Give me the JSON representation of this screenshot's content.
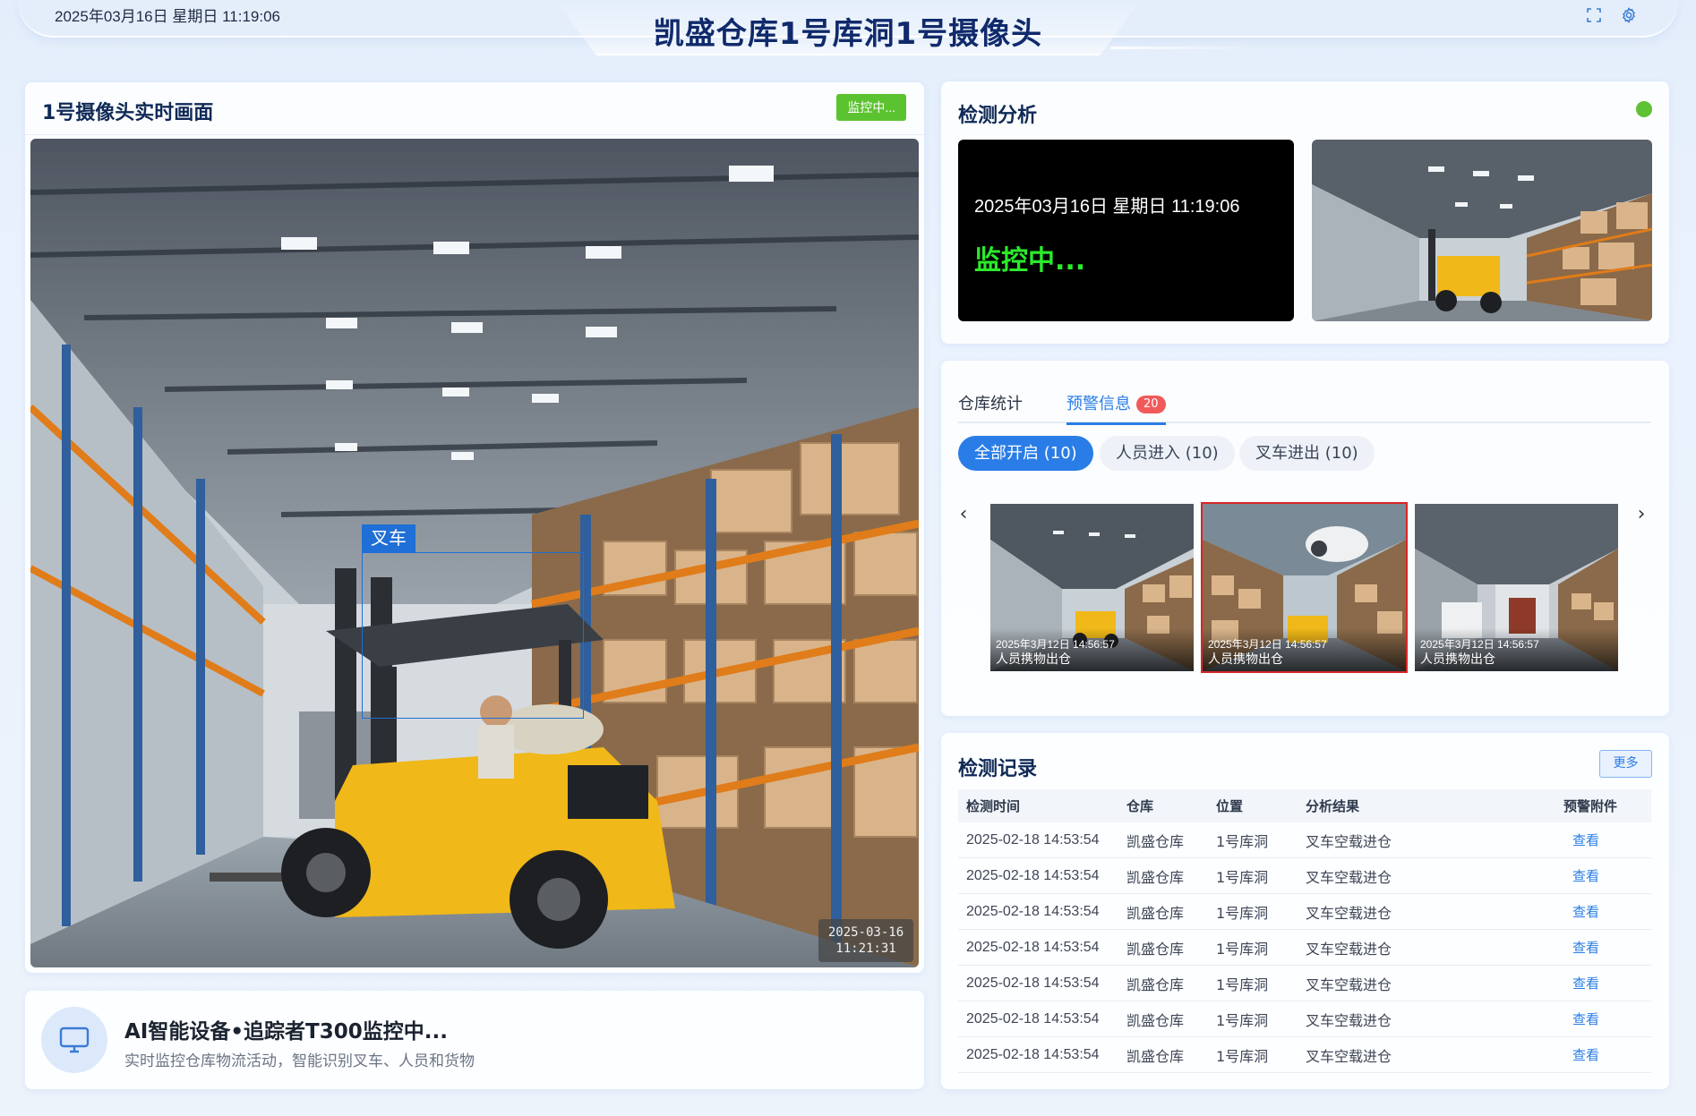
{
  "header": {
    "datetime": "2025年03月16日 星期日 11:19:06",
    "title": "凯盛仓库1号库洞1号摄像头",
    "icons": [
      "fullscreen-icon",
      "settings-icon"
    ]
  },
  "live": {
    "title": "1号摄像头实时画面",
    "status": "监控中...",
    "detection_label": "叉车",
    "timestamp_date": "2025-03-16",
    "timestamp_time": "11:21:31"
  },
  "info": {
    "icon": "monitor-icon",
    "title": "AI智能设备•追踪者T300监控中...",
    "subtitle": "实时监控仓库物流活动，智能识别叉车、人员和货物"
  },
  "analysis": {
    "title": "检测分析",
    "screen_datetime": "2025年03月16日 星期日 11:19:06",
    "screen_status": "监控中..."
  },
  "alerts": {
    "tabs": [
      {
        "label": "仓库统计"
      },
      {
        "label": "预警信息",
        "badge": "20"
      }
    ],
    "filters": [
      "全部开启 (10)",
      "人员进入 (10)",
      "叉车进出 (10)"
    ],
    "prev_arrow": "‹",
    "next_arrow": "›",
    "slides": [
      {
        "time": "2025年3月12日 14:56:57",
        "desc": "人员携物出仓"
      },
      {
        "time": "2025年3月12日 14:56:57",
        "desc": "人员携物出仓"
      },
      {
        "time": "2025年3月12日 14:56:57",
        "desc": "人员携物出仓"
      }
    ]
  },
  "records": {
    "title": "检测记录",
    "more": "更多",
    "columns": [
      "检测时间",
      "仓库",
      "位置",
      "分析结果",
      "预警附件"
    ],
    "rows": [
      [
        "2025-02-18 14:53:54",
        "凯盛仓库",
        "1号库洞",
        "叉车空载进仓",
        "查看"
      ],
      [
        "2025-02-18 14:53:54",
        "凯盛仓库",
        "1号库洞",
        "叉车空载进仓",
        "查看"
      ],
      [
        "2025-02-18 14:53:54",
        "凯盛仓库",
        "1号库洞",
        "叉车空载进仓",
        "查看"
      ],
      [
        "2025-02-18 14:53:54",
        "凯盛仓库",
        "1号库洞",
        "叉车空载进仓",
        "查看"
      ],
      [
        "2025-02-18 14:53:54",
        "凯盛仓库",
        "1号库洞",
        "叉车空载进仓",
        "查看"
      ],
      [
        "2025-02-18 14:53:54",
        "凯盛仓库",
        "1号库洞",
        "叉车空载进仓",
        "查看"
      ],
      [
        "2025-02-18 14:53:54",
        "凯盛仓库",
        "1号库洞",
        "叉车空载进仓",
        "查看"
      ]
    ]
  },
  "colors": {
    "primary": "#2a7de6",
    "live_green": "#5cc330",
    "alert_red": "#f15a5a",
    "title_navy": "#102a6b",
    "screen_green": "#2bea2b"
  }
}
